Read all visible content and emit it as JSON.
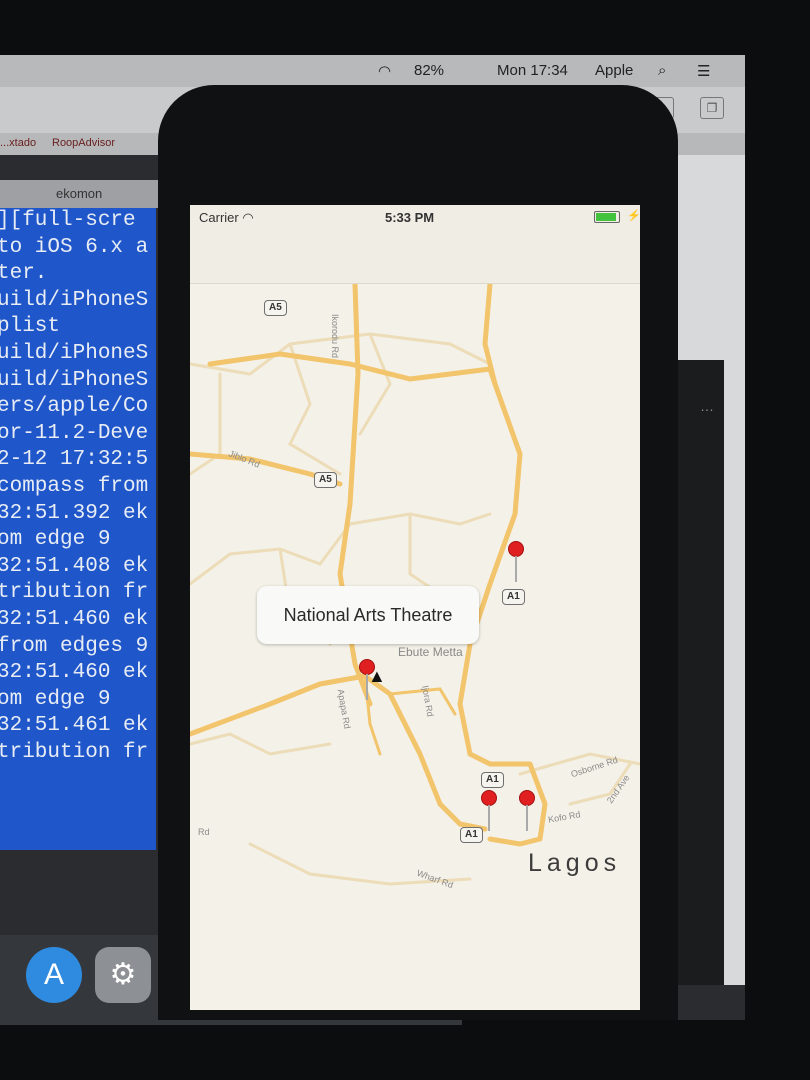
{
  "mac": {
    "menubar": {
      "wifi_icon": "wifi-icon",
      "battery": "82%",
      "clock": "Mon 17:34",
      "user": "Apple",
      "search_icon": "spotlight-icon",
      "list_icon": "notification-center-icon"
    },
    "bookmarks": [
      "...xtado",
      "RoopAdvisor"
    ],
    "terminal_tab": "ekomon",
    "terminal_lines": [
      "][full-scre",
      "to iOS 6.x a",
      "ter.",
      "uild/iPhoneS",
      "plist",
      "uild/iPhoneS",
      "",
      "uild/iPhoneS",
      "",
      "ers/apple/Co",
      "or-11.2-Deve",
      "2-12 17:32:5",
      "compass from",
      "32:51.392 ek",
      "om edge 9",
      "32:51.408 ek",
      "tribution fr",
      "32:51.460 ek",
      "from edges 9",
      "32:51.460 ek",
      "om edge 9",
      "32:51.461 ek",
      "tribution fr"
    ],
    "dock_icons": [
      "app-store-icon",
      "system-preferences-icon",
      "vscode-icon",
      "visual-studio-icon",
      "simulator-icon"
    ]
  },
  "phone": {
    "status": {
      "carrier": "Carrier",
      "time": "5:33 PM"
    },
    "map": {
      "shields": [
        "A5",
        "A5",
        "A1",
        "A1",
        "A1"
      ],
      "road_labels": [
        "Ikorodu Rd",
        "Jiblo Rd",
        "Apapa Rd",
        "Ijora Rd",
        "Osborne Rd",
        "Kofo Rd",
        "2nd Ave",
        "Wharf Rd",
        "Rd"
      ],
      "district": "Ebute Metta",
      "city": "Lagos",
      "callout_title": "National Arts Theatre",
      "road_color": "#f2c46b"
    }
  }
}
